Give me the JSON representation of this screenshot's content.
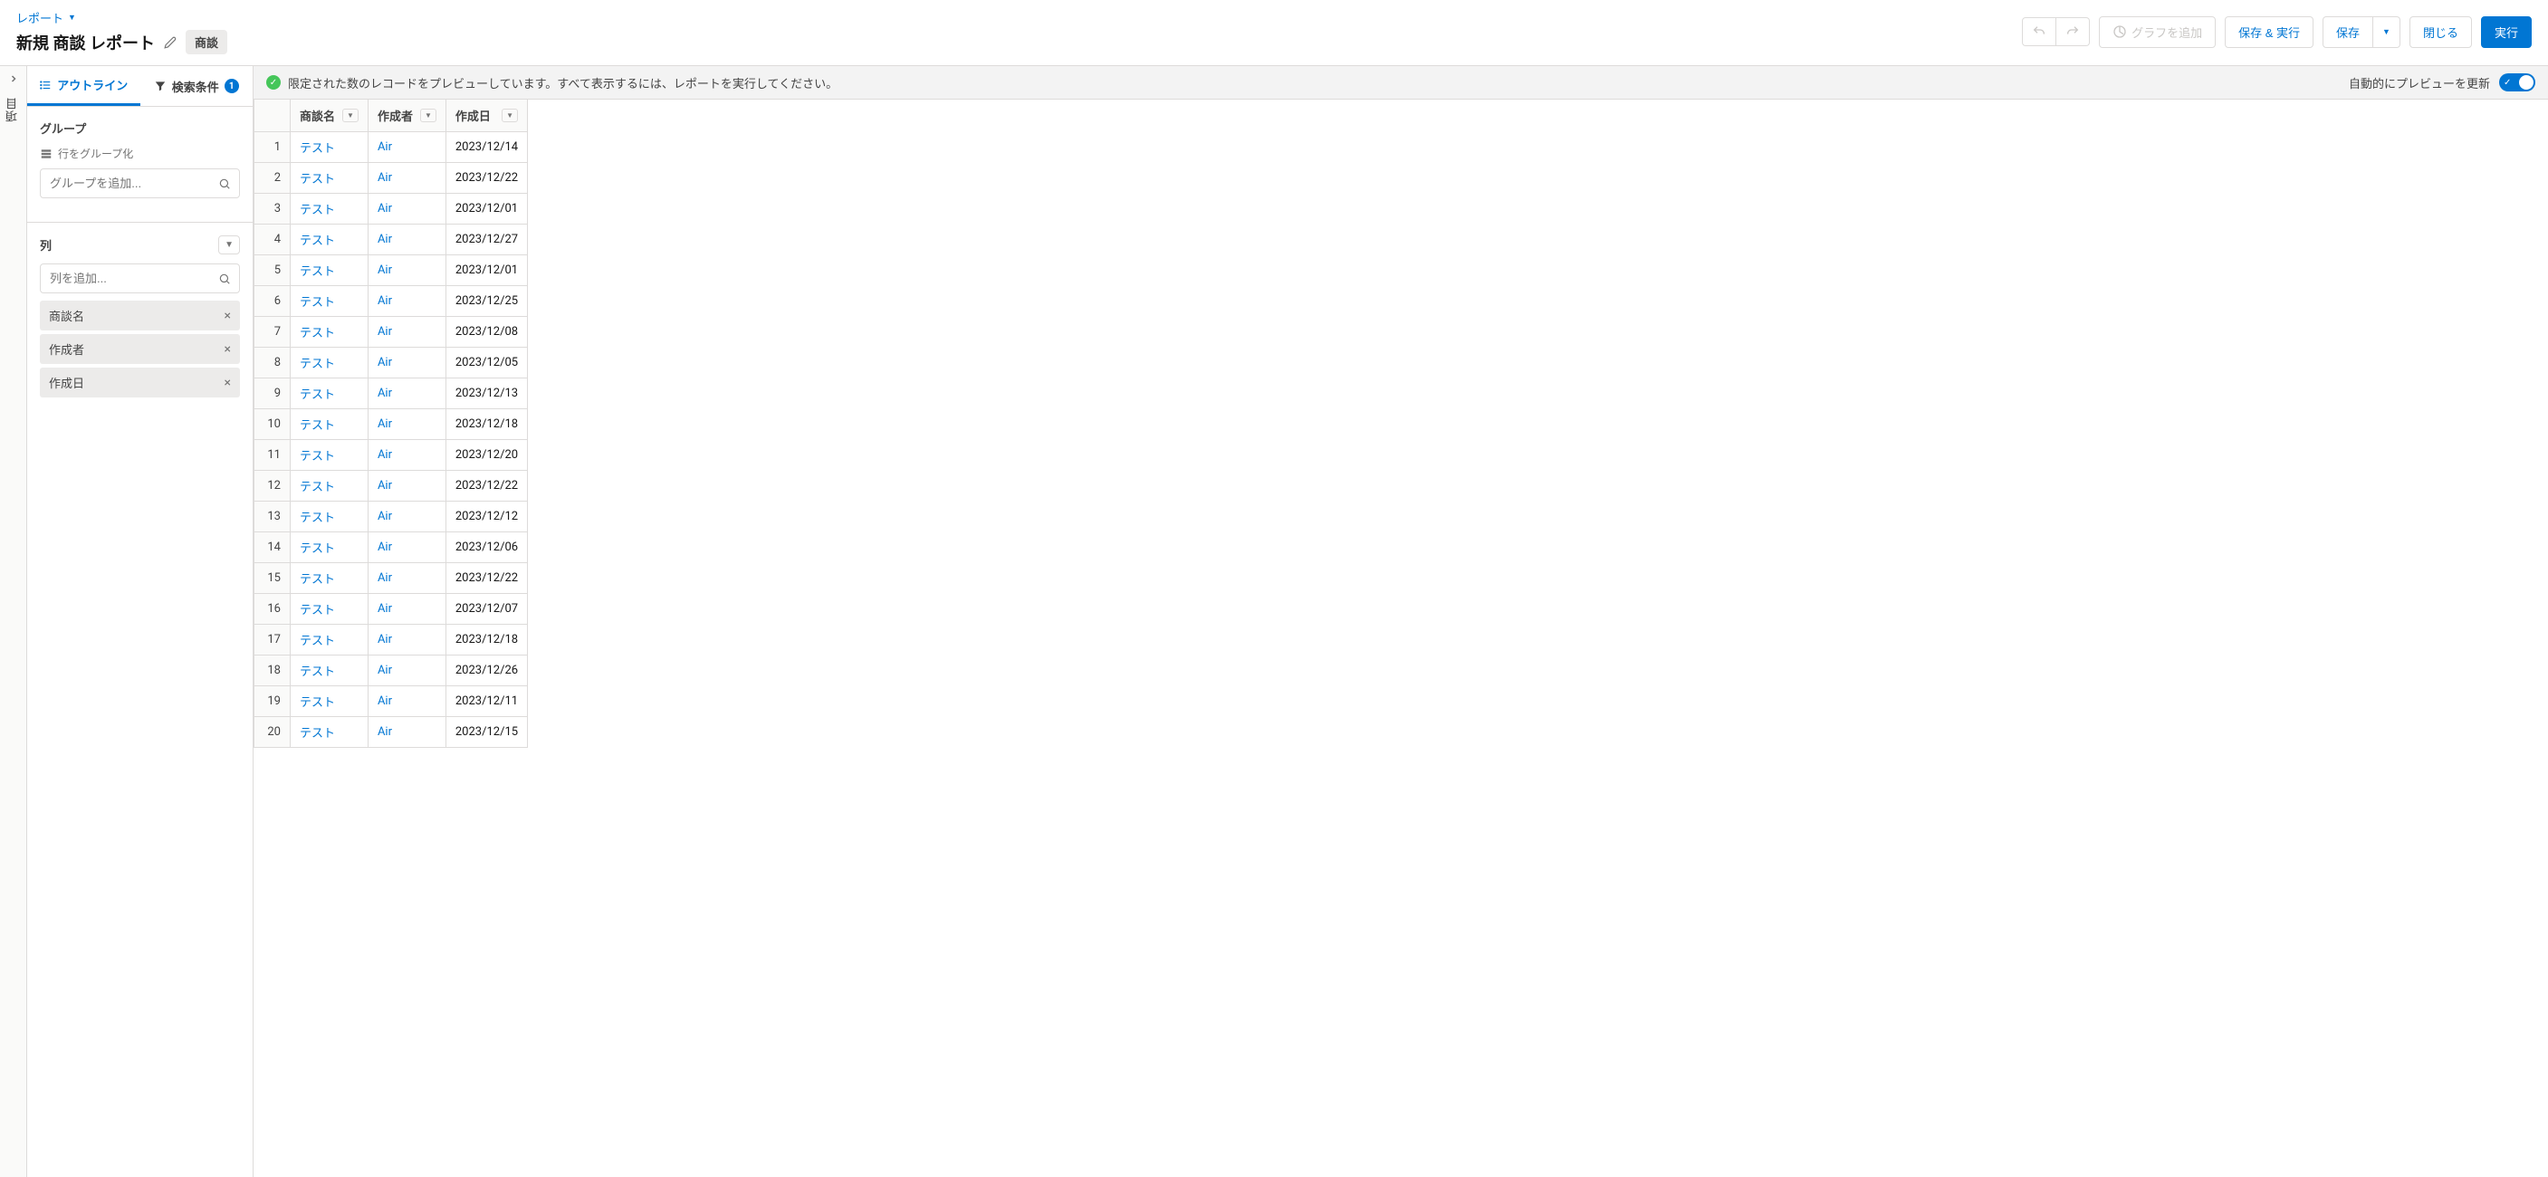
{
  "header": {
    "breadcrumb": "レポート",
    "title": "新規 商談 レポート",
    "badge": "商談"
  },
  "toolbar": {
    "add_chart": "グラフを追加",
    "save_run": "保存 & 実行",
    "save": "保存",
    "close": "閉じる",
    "run": "実行"
  },
  "rail": {
    "label": "項目"
  },
  "sidebar": {
    "tabs": {
      "outline": "アウトライン",
      "filters": "検索条件",
      "filter_count": "1"
    },
    "group_section": {
      "title": "グループ",
      "sub_label": "行をグループ化",
      "placeholder": "グループを追加..."
    },
    "columns_section": {
      "title": "列",
      "placeholder": "列を追加...",
      "chips": [
        "商談名",
        "作成者",
        "作成日"
      ]
    }
  },
  "info_bar": {
    "message": "限定された数のレコードをプレビューしています。すべて表示するには、レポートを実行してください。",
    "auto_preview": "自動的にプレビューを更新"
  },
  "table": {
    "headers": [
      "商談名",
      "作成者",
      "作成日"
    ],
    "rows": [
      {
        "n": "1",
        "name": "テスト",
        "creator": "Air",
        "date": "2023/12/14"
      },
      {
        "n": "2",
        "name": "テスト",
        "creator": "Air",
        "date": "2023/12/22"
      },
      {
        "n": "3",
        "name": "テスト",
        "creator": "Air",
        "date": "2023/12/01"
      },
      {
        "n": "4",
        "name": "テスト",
        "creator": "Air",
        "date": "2023/12/27"
      },
      {
        "n": "5",
        "name": "テスト",
        "creator": "Air",
        "date": "2023/12/01"
      },
      {
        "n": "6",
        "name": "テスト",
        "creator": "Air",
        "date": "2023/12/25"
      },
      {
        "n": "7",
        "name": "テスト",
        "creator": "Air",
        "date": "2023/12/08"
      },
      {
        "n": "8",
        "name": "テスト",
        "creator": "Air",
        "date": "2023/12/05"
      },
      {
        "n": "9",
        "name": "テスト",
        "creator": "Air",
        "date": "2023/12/13"
      },
      {
        "n": "10",
        "name": "テスト",
        "creator": "Air",
        "date": "2023/12/18"
      },
      {
        "n": "11",
        "name": "テスト",
        "creator": "Air",
        "date": "2023/12/20"
      },
      {
        "n": "12",
        "name": "テスト",
        "creator": "Air",
        "date": "2023/12/22"
      },
      {
        "n": "13",
        "name": "テスト",
        "creator": "Air",
        "date": "2023/12/12"
      },
      {
        "n": "14",
        "name": "テスト",
        "creator": "Air",
        "date": "2023/12/06"
      },
      {
        "n": "15",
        "name": "テスト",
        "creator": "Air",
        "date": "2023/12/22"
      },
      {
        "n": "16",
        "name": "テスト",
        "creator": "Air",
        "date": "2023/12/07"
      },
      {
        "n": "17",
        "name": "テスト",
        "creator": "Air",
        "date": "2023/12/18"
      },
      {
        "n": "18",
        "name": "テスト",
        "creator": "Air",
        "date": "2023/12/26"
      },
      {
        "n": "19",
        "name": "テスト",
        "creator": "Air",
        "date": "2023/12/11"
      },
      {
        "n": "20",
        "name": "テスト",
        "creator": "Air",
        "date": "2023/12/15"
      }
    ]
  }
}
